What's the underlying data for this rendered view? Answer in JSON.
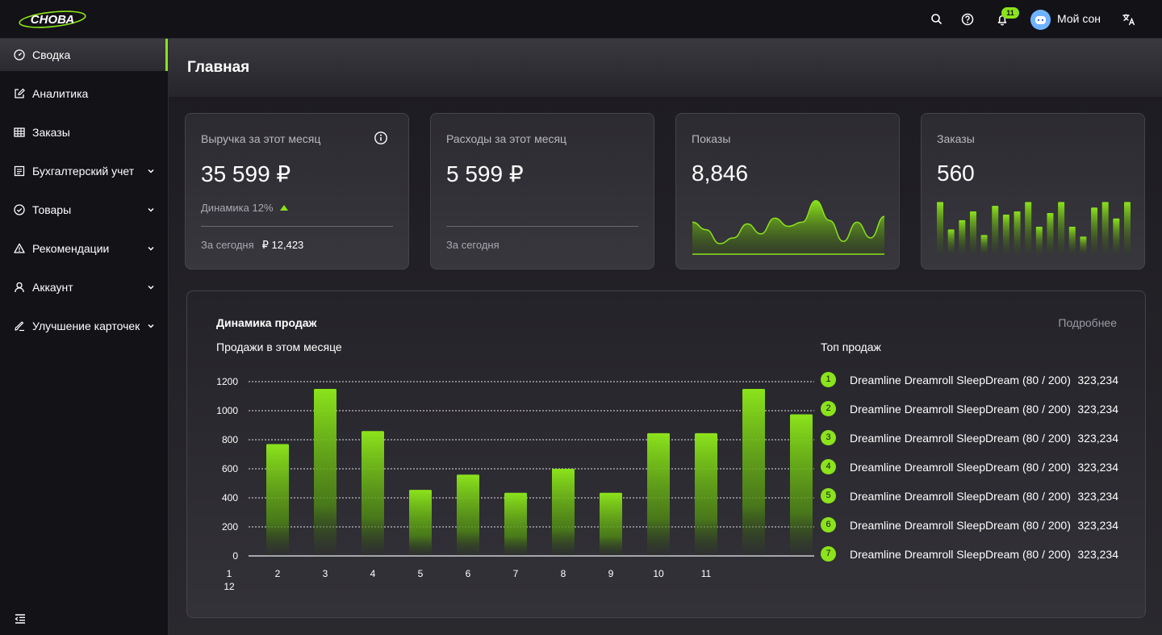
{
  "brand": {
    "logo_text": "СНОВА",
    "accent": "#8be31b"
  },
  "topbar": {
    "notification_count": "11",
    "username": "Мой сон",
    "icons": [
      "search-icon",
      "help-icon",
      "bell-icon",
      "avatar",
      "translate-icon"
    ]
  },
  "sidebar": {
    "items": [
      {
        "label": "Сводка",
        "icon": "dashboard-icon",
        "active": true,
        "expandable": false
      },
      {
        "label": "Аналитика",
        "icon": "edit-icon",
        "active": false,
        "expandable": false
      },
      {
        "label": "Заказы",
        "icon": "table-icon",
        "active": false,
        "expandable": false
      },
      {
        "label": "Бухгалтерский учет",
        "icon": "document-icon",
        "active": false,
        "expandable": true
      },
      {
        "label": "Товары",
        "icon": "check-circle-icon",
        "active": false,
        "expandable": true
      },
      {
        "label": "Рекомендации",
        "icon": "warning-icon",
        "active": false,
        "expandable": true
      },
      {
        "label": "Аккаунт",
        "icon": "user-icon",
        "active": false,
        "expandable": true
      },
      {
        "label": "Улучшение карточек",
        "icon": "brush-icon",
        "active": false,
        "expandable": true
      }
    ]
  },
  "page": {
    "title": "Главная"
  },
  "cards": {
    "revenue": {
      "title": "Выручка за этот месяц",
      "value": "35 599 ₽",
      "dynamics": "Динамика 12%",
      "today_label": "За сегодня",
      "today_value": "₽ 12,423"
    },
    "expenses": {
      "title": "Расходы за этот месяц",
      "value": "5 599 ₽",
      "today_label": "За сегодня"
    },
    "impressions": {
      "title": "Показы",
      "value": "8,846"
    },
    "orders": {
      "title": "Заказы",
      "value": "560"
    }
  },
  "sales": {
    "title": "Динамика продаж",
    "more": "Подробнее",
    "chart_title": "Продажи в этом месяце",
    "top_title": "Топ продаж",
    "top": [
      {
        "rank": "1",
        "name": "Dreamline Dreamroll SleepDream (80 / 200)",
        "value": "323,234"
      },
      {
        "rank": "2",
        "name": "Dreamline Dreamroll SleepDream (80 / 200)",
        "value": "323,234"
      },
      {
        "rank": "3",
        "name": "Dreamline Dreamroll SleepDream (80 / 200)",
        "value": "323,234"
      },
      {
        "rank": "4",
        "name": "Dreamline Dreamroll SleepDream (80 / 200)",
        "value": "323,234"
      },
      {
        "rank": "5",
        "name": "Dreamline Dreamroll SleepDream (80 / 200)",
        "value": "323,234"
      },
      {
        "rank": "6",
        "name": "Dreamline Dreamroll SleepDream (80 / 200)",
        "value": "323,234"
      },
      {
        "rank": "7",
        "name": "Dreamline Dreamroll SleepDream (80 / 200)",
        "value": "323,234"
      }
    ]
  },
  "chart_data": [
    {
      "type": "bar",
      "categories": [
        "1",
        "2",
        "3",
        "4",
        "5",
        "6",
        "7",
        "8",
        "9",
        "10",
        "11",
        "12"
      ],
      "values": [
        770,
        1150,
        860,
        455,
        560,
        435,
        600,
        435,
        845,
        845,
        1150,
        975
      ],
      "ylim": [
        0,
        1200
      ],
      "yticks": [
        "0",
        "200",
        "400",
        "600",
        "800",
        "1000",
        "1200"
      ],
      "grid": true
    },
    {
      "type": "area",
      "values": [
        0.55,
        0.42,
        0.18,
        0.28,
        0.52,
        0.35,
        0.62,
        0.48,
        0.55,
        0.92,
        0.58,
        0.22,
        0.55,
        0.28,
        0.65
      ]
    },
    {
      "type": "bar",
      "values": [
        0.95,
        0.45,
        0.62,
        0.78,
        0.35,
        0.88,
        0.72,
        0.78,
        0.95,
        0.5,
        0.75,
        0.95,
        0.5,
        0.32,
        0.85,
        0.95,
        0.65,
        0.95
      ]
    }
  ]
}
